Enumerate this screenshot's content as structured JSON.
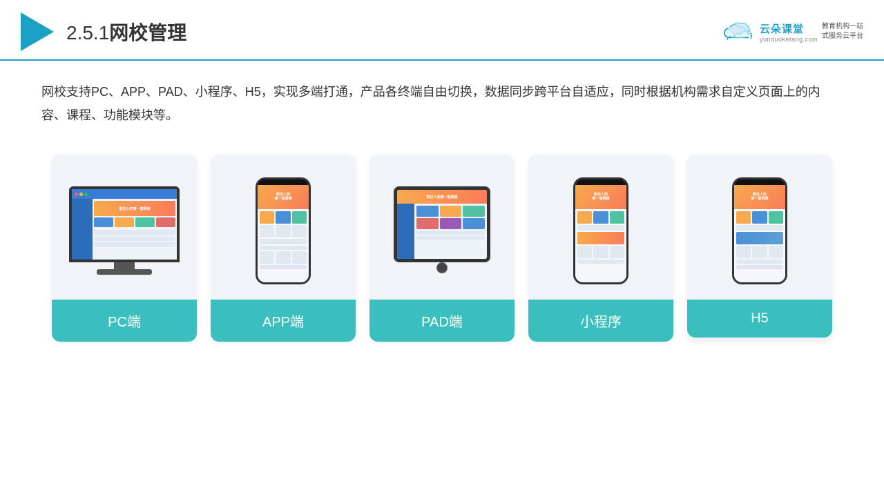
{
  "header": {
    "title_prefix": "2.5.1",
    "title_main": "网校管理",
    "logo_alt": "云朵课堂",
    "brand_name": "云朵课堂",
    "brand_url": "yunduoketang.com",
    "brand_slogan_line1": "教育机构一站",
    "brand_slogan_line2": "式服务云平台"
  },
  "description": {
    "text": "网校支持PC、APP、PAD、小程序、H5，实现多端打通，产品各终端自由切换，数据同步跨平台自适应，同时根据机构需求自定义页面上的内容、课程、功能模块等。"
  },
  "cards": [
    {
      "id": "pc",
      "label": "PC端"
    },
    {
      "id": "app",
      "label": "APP端"
    },
    {
      "id": "pad",
      "label": "PAD端"
    },
    {
      "id": "mini-program",
      "label": "小程序"
    },
    {
      "id": "h5",
      "label": "H5"
    }
  ]
}
